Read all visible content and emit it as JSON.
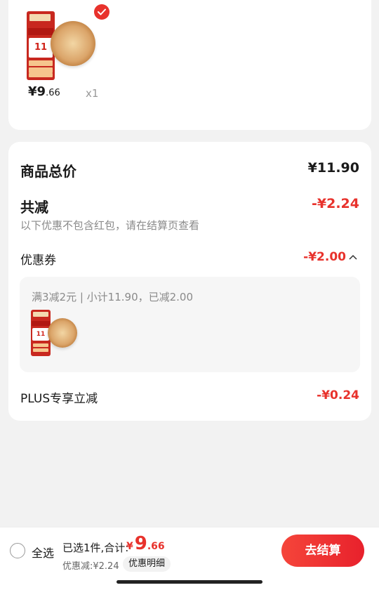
{
  "product": {
    "thumb_price": "11",
    "price_symbol": "¥",
    "price_int": "9",
    "price_dec": ".66",
    "quantity": "x1"
  },
  "summary": {
    "total_label": "商品总价",
    "total_value": "¥11.90",
    "reduce_label": "共减",
    "reduce_value": "-¥2.24",
    "reduce_hint": "以下优惠不包含红包，请在结算页查看",
    "coupon_label": "优惠券",
    "coupon_value": "-¥2.00",
    "coupon_desc": "满3减2元 | 小计11.90，已减2.00",
    "plus_label": "PLUS专享立减",
    "plus_value": "-¥0.24"
  },
  "bottom": {
    "select_all": "全选",
    "selected": "已选1件,合计:",
    "total_yen": "¥",
    "total_int": "9",
    "total_dec": ".66",
    "discount": "优惠减:¥2.24",
    "detail_button": "优惠明细",
    "checkout_button": "去结算"
  },
  "colors": {
    "accent": "#e8322c",
    "background": "#f2f2f2"
  },
  "icons": {
    "check": "check-icon",
    "chevron": "chevron-up-icon",
    "radio": "radio-icon"
  }
}
